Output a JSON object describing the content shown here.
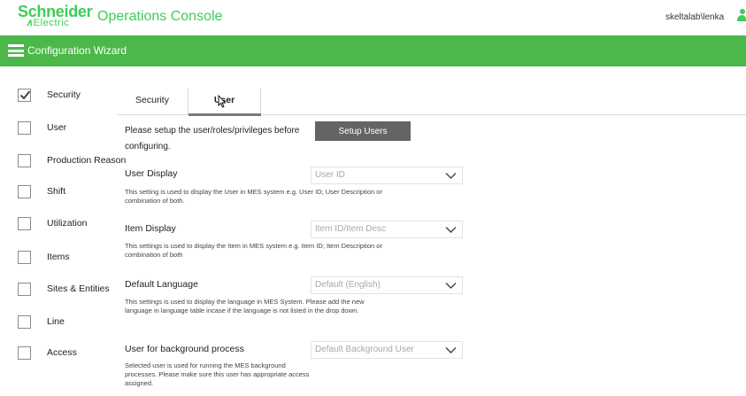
{
  "header": {
    "logo_top": "Schneider",
    "logo_bottom": "Electric",
    "app_title": "Operations Console",
    "user_name": "skeltalab\\lenka"
  },
  "wizard_bar": {
    "title": "Configuration Wizard"
  },
  "sidebar": {
    "items": [
      {
        "label": "Security",
        "checked": true
      },
      {
        "label": "User",
        "checked": false
      },
      {
        "label": "Production Reason",
        "checked": false
      },
      {
        "label": "Shift",
        "checked": false
      },
      {
        "label": "Utilization",
        "checked": false
      },
      {
        "label": "Items",
        "checked": false
      },
      {
        "label": "Sites & Entities",
        "checked": false
      },
      {
        "label": "Line",
        "checked": false
      },
      {
        "label": "Access",
        "checked": false
      }
    ]
  },
  "tabs": [
    {
      "label": "Security",
      "active": false
    },
    {
      "label": "User",
      "active": true
    }
  ],
  "main": {
    "intro_text": "Please setup the user/roles/privileges before configuring.",
    "setup_button": "Setup Users",
    "settings": [
      {
        "label": "User Display",
        "value": "User ID",
        "description": "This setting is used to display the User in MES system e.g. User ID; User Description or combination of both."
      },
      {
        "label": "Item Display",
        "value": "Item ID/Item Desc",
        "description": "This settings is used to display the Item in MES system e.g. Item ID; Item Description or combination of both"
      },
      {
        "label": "Default Language",
        "value": "Default (English)",
        "description": "This settings is used to display the language in MES System. Please add the new language in language table incase if the language is not listed in the drop down."
      },
      {
        "label": "User for background process",
        "value": "Default Background User",
        "description": "Selected user is used for running the MES background processes. Please make sure this user has appropriate access assigned."
      }
    ]
  },
  "colors": {
    "brand_green": "#3dcd58",
    "bar_green": "#4cb849",
    "button_gray": "#646464"
  }
}
